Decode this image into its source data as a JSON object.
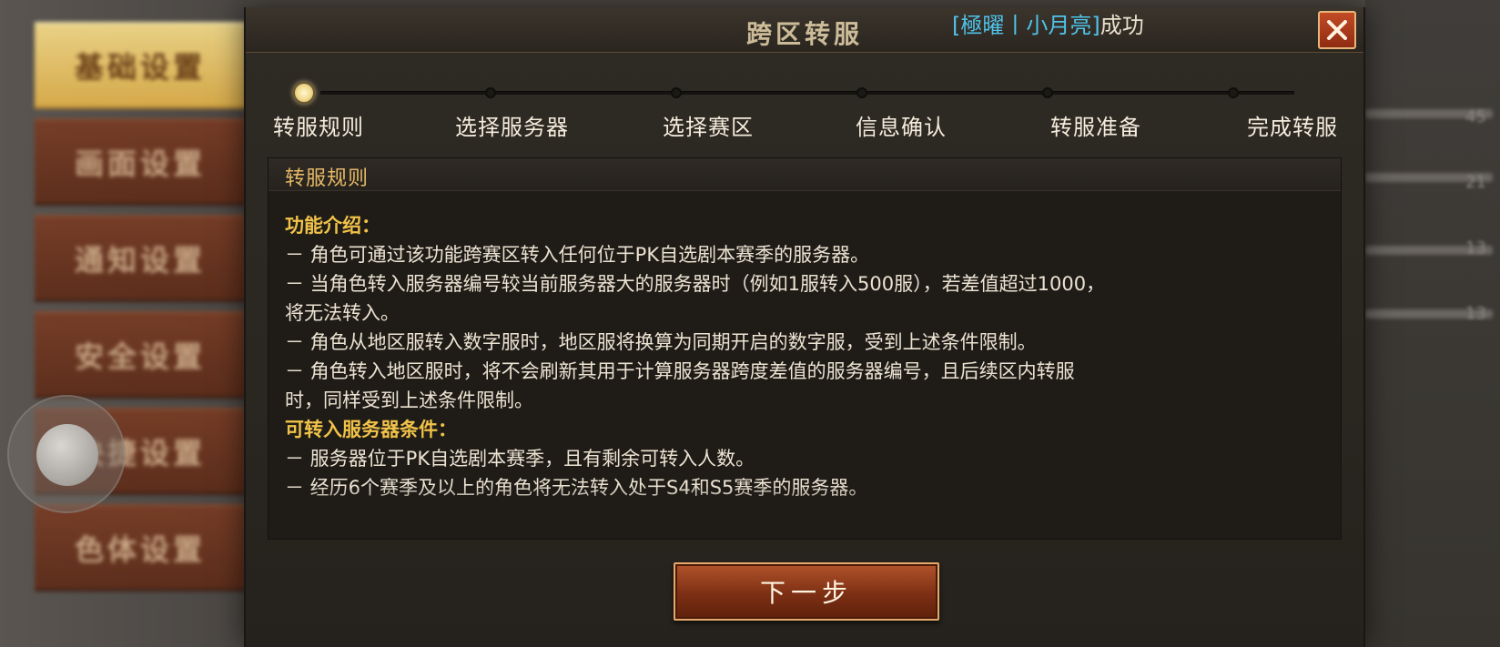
{
  "sidebar": {
    "items": [
      {
        "label": "基础设置",
        "active": true
      },
      {
        "label": "画面设置",
        "active": false
      },
      {
        "label": "通知设置",
        "active": false
      },
      {
        "label": "安全设置",
        "active": false
      },
      {
        "label": "快捷设置",
        "active": false
      },
      {
        "label": "色体设置",
        "active": false
      }
    ]
  },
  "background_numbers": [
    "45",
    "21",
    "13",
    "13"
  ],
  "modal": {
    "title": "跨区转服",
    "close_icon": "close-icon",
    "notification": {
      "name": "[極曜丨小月亮]",
      "message": "成功"
    }
  },
  "steps": [
    {
      "label": "转服规则",
      "active": true
    },
    {
      "label": "选择服务器",
      "active": false
    },
    {
      "label": "选择赛区",
      "active": false
    },
    {
      "label": "信息确认",
      "active": false
    },
    {
      "label": "转服准备",
      "active": false
    },
    {
      "label": "完成转服",
      "active": false
    }
  ],
  "rules": {
    "header": "转服规则",
    "section1_title": "功能介绍：",
    "section1_lines": [
      "－ 角色可通过该功能跨赛区转入任何位于PK自选剧本赛季的服务器。",
      "－ 当角色转入服务器编号较当前服务器大的服务器时（例如1服转入500服），若差值超过1000，",
      "将无法转入。",
      "－ 角色从地区服转入数字服时，地区服将换算为同期开启的数字服，受到上述条件限制。",
      "－ 角色转入地区服时，将不会刷新其用于计算服务器跨度差值的服务器编号，且后续区内转服",
      "时，同样受到上述条件限制。"
    ],
    "section2_title": "可转入服务器条件：",
    "section2_lines": [
      "－ 服务器位于PK自选剧本赛季，且有剩余可转入人数。",
      "－ 经历6个赛季及以上的角色将无法转入处于S4和S5赛季的服务器。"
    ]
  },
  "next_button": "下一步",
  "colors": {
    "accent_gold": "#f1c248",
    "notify_blue": "#4fc3ea",
    "button_red": "#7d2f14"
  }
}
